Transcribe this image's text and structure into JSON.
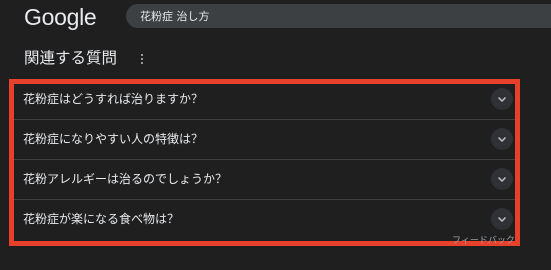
{
  "header": {
    "logo_text": "Google",
    "search_query": "花粉症 治し方"
  },
  "related": {
    "title": "関連する質問",
    "more_icon": "more-vert-icon",
    "questions": [
      {
        "label": "花粉症はどうすれば治りますか？"
      },
      {
        "label": "花粉症になりやすい人の特徴は？"
      },
      {
        "label": "花粉アレルギーは治るのでしょうか？"
      },
      {
        "label": "花粉症が楽になる食べ物は？"
      }
    ],
    "feedback_label": "フィードバック"
  },
  "colors": {
    "background": "#1f1f1f",
    "text": "#e8eaed",
    "highlight_border": "#e8412b"
  }
}
